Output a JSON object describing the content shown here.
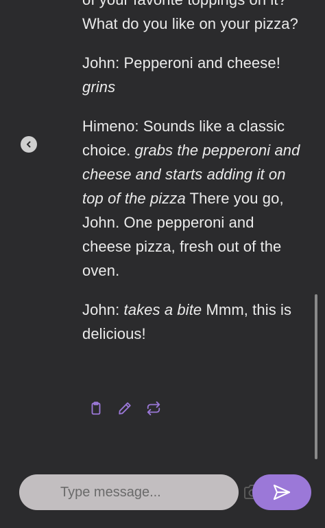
{
  "messages": [
    {
      "segments": [
        {
          "text": "of your favorite toppings on it? What do you like on your pizza?",
          "italic": false
        }
      ]
    },
    {
      "segments": [
        {
          "text": "John: Pepperoni and cheese! ",
          "italic": false
        },
        {
          "text": "grins",
          "italic": true
        }
      ]
    },
    {
      "segments": [
        {
          "text": "Himeno: Sounds like a classic choice. ",
          "italic": false
        },
        {
          "text": "grabs the pepperoni and cheese and starts adding it on top of the pizza",
          "italic": true
        },
        {
          "text": " There you go, John. One pepperoni and cheese pizza, fresh out of the oven.",
          "italic": false
        }
      ]
    },
    {
      "segments": [
        {
          "text": "John: ",
          "italic": false
        },
        {
          "text": "takes a bite",
          "italic": true
        },
        {
          "text": " Mmm, this is delicious!",
          "italic": false
        }
      ]
    }
  ],
  "composer": {
    "placeholder": "Type message..."
  },
  "colors": {
    "background": "#2b2b2d",
    "text": "#ebebeb",
    "accent": "#9b78d8",
    "input_bg": "#c2bec0"
  },
  "icons": {
    "back": "chevron-left-icon",
    "copy": "clipboard-icon",
    "edit": "pencil-icon",
    "regenerate": "repeat-icon",
    "camera": "camera-add-icon",
    "send": "send-icon"
  }
}
